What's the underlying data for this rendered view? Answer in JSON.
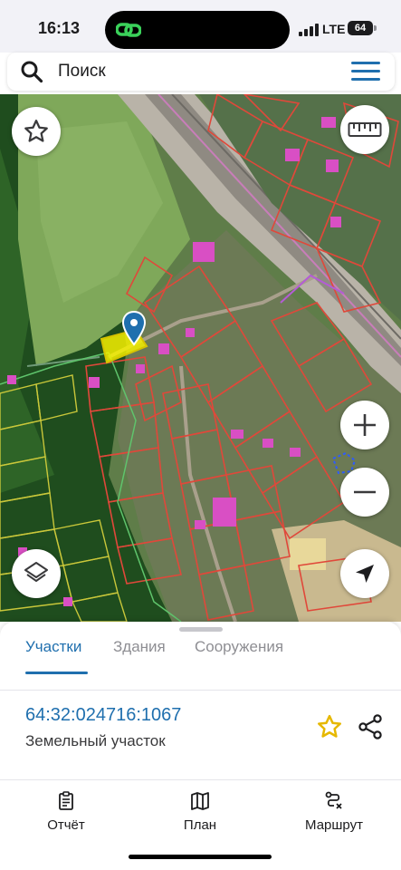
{
  "status_bar": {
    "time": "16:13",
    "network": "LTE",
    "battery": "64",
    "island_icon": "link-chain-icon"
  },
  "search": {
    "placeholder": "Поиск",
    "search_icon": "search-icon",
    "menu_icon": "menu-icon"
  },
  "map": {
    "controls": [
      "favorite-star-icon",
      "ruler-icon",
      "zoom-in-icon",
      "zoom-out-icon",
      "layers-icon",
      "locate-arrow-icon"
    ],
    "selected_parcel_color": "#f5f000",
    "parcel_border_color": "#e0483a",
    "building_color": "#d94fc4",
    "pin_color": "#1f6fae"
  },
  "sheet": {
    "tabs": [
      {
        "label": "Участки",
        "active": true
      },
      {
        "label": "Здания",
        "active": false
      },
      {
        "label": "Сооружения",
        "active": false
      }
    ],
    "parcel": {
      "number": "64:32:024716:1067",
      "type": "Земельный участок"
    },
    "accent_color": "#1f6fae",
    "favorite_color": "#e6b800"
  },
  "tabbar": {
    "items": [
      {
        "label": "Отчёт",
        "icon": "clipboard-icon"
      },
      {
        "label": "План",
        "icon": "map-icon"
      },
      {
        "label": "Маршрут",
        "icon": "route-icon"
      }
    ]
  }
}
